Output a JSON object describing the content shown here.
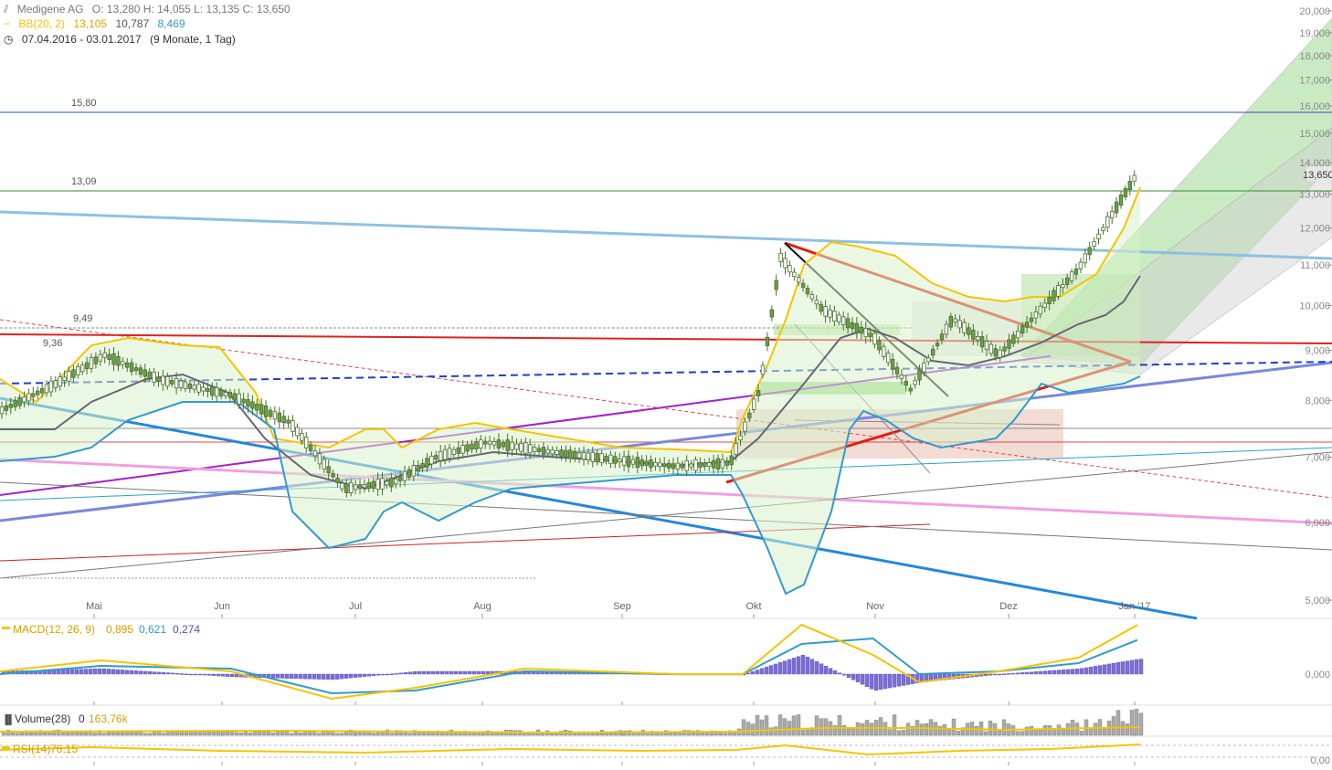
{
  "header": {
    "symbol": "Medigene AG",
    "ohlc": "O: 13,280  H: 14,055  L: 13,135  C: 13,650",
    "bb_label": "BB(20, 2)",
    "bb_upper": "13,105",
    "bb_mid": "10,787",
    "bb_lower": "8,469",
    "date_range": "07.04.2016 - 03.01.2017",
    "period": "(9 Monate, 1 Tag)"
  },
  "colors": {
    "candle_up": "#6b9e4a",
    "bb_upper": "#f5c400",
    "bb_mid": "#666677",
    "bb_lower": "#3399cc",
    "macd_line": "#f5c400",
    "signal_line": "#3399cc",
    "histogram": "#7a6fd6",
    "volume": "#aaaaaa",
    "volume_avg": "#f5c400",
    "rsi": "#f5c400"
  },
  "level_labels": {
    "l1580": "15,80",
    "l1309": "13,09",
    "l949": "9,49",
    "l936": "9,36"
  },
  "last_price_tag": "13,650",
  "macd": {
    "label": "MACD(12, 26, 9)",
    "v1": "0,895",
    "v2": "0,621",
    "v3": "0,274",
    "axis_zero": "0,000"
  },
  "volume": {
    "label": "Volume(28)",
    "v1": "0",
    "v2": "163,76k"
  },
  "rsi": {
    "label": "RSI(14)",
    "v1": "76,15",
    "axis_zero": "0,00"
  },
  "chart_data": {
    "type": "line",
    "title": "Medigene AG",
    "ylim": [
      5.0,
      20.0
    ],
    "y_ticks": [
      "5,000",
      "6,000",
      "7,000",
      "8,000",
      "9,000",
      "10,000",
      "11,000",
      "12,000",
      "13,000",
      "14,000",
      "15,000",
      "16,000",
      "17,000",
      "18,000",
      "19,000",
      "20,000"
    ],
    "x_ticks": [
      "Mai",
      "Jun",
      "Jul",
      "Aug",
      "Sep",
      "Okt",
      "Nov",
      "Dez",
      "Jan '17"
    ],
    "horizontal_levels": [
      15.8,
      13.09,
      9.49,
      9.36
    ],
    "price_series": {
      "name": "Close",
      "x": [
        "2016-04-07",
        "2016-04-20",
        "2016-05-02",
        "2016-05-15",
        "2016-06-01",
        "2016-06-15",
        "2016-06-28",
        "2016-07-10",
        "2016-07-20",
        "2016-08-01",
        "2016-08-15",
        "2016-09-01",
        "2016-09-15",
        "2016-09-28",
        "2016-10-05",
        "2016-10-10",
        "2016-10-20",
        "2016-11-01",
        "2016-11-10",
        "2016-11-20",
        "2016-12-01",
        "2016-12-10",
        "2016-12-20",
        "2017-01-03"
      ],
      "y": [
        7.8,
        8.3,
        8.9,
        8.4,
        8.1,
        7.6,
        6.5,
        6.6,
        7.0,
        7.25,
        7.1,
        6.95,
        6.85,
        6.9,
        8.2,
        11.2,
        9.9,
        9.3,
        8.2,
        9.7,
        8.9,
        9.8,
        10.9,
        13.65
      ]
    },
    "bollinger": {
      "label": "BB(20, 2)",
      "upper": [
        8.3,
        8.7,
        9.5,
        9.2,
        8.9,
        8.2,
        7.2,
        6.5,
        7.5,
        7.6,
        7.4,
        7.2,
        7.05,
        7.15,
        8.5,
        11.3,
        11.7,
        11.2,
        10.2,
        10.3,
        10.2,
        10.3,
        11.0,
        13.1
      ],
      "middle": [
        7.8,
        8.1,
        8.4,
        8.5,
        8.1,
        7.5,
        6.8,
        6.6,
        6.8,
        7.0,
        7.0,
        6.95,
        6.85,
        6.75,
        7.0,
        7.8,
        8.9,
        9.5,
        9.1,
        9.2,
        9.1,
        9.3,
        9.7,
        10.79
      ]
    },
    "macd_series": {
      "name": "MACD(12, 26, 9)",
      "x": [
        "2016-04-07",
        "2016-05-01",
        "2016-06-01",
        "2016-06-25",
        "2016-07-15",
        "2016-08-10",
        "2016-09-15",
        "2016-10-01",
        "2016-10-15",
        "2016-11-01",
        "2016-11-12",
        "2016-12-01",
        "2016-12-20",
        "2017-01-03"
      ],
      "macd": [
        0.05,
        0.25,
        0.05,
        -0.45,
        -0.25,
        0.1,
        0.0,
        0.0,
        0.9,
        0.35,
        -0.15,
        0.05,
        0.3,
        0.895
      ],
      "signal": [
        0.0,
        0.15,
        0.1,
        -0.35,
        -0.3,
        0.05,
        0.0,
        0.0,
        0.55,
        0.65,
        0.0,
        0.05,
        0.2,
        0.621
      ],
      "histogram": [
        0.05,
        0.1,
        -0.05,
        -0.1,
        0.05,
        0.05,
        0.0,
        0.0,
        0.35,
        -0.3,
        -0.15,
        0.0,
        0.1,
        0.274
      ]
    },
    "volume_series": {
      "name": "Volume(28)",
      "average": 163760
    },
    "rsi_series": {
      "name": "RSI(14)",
      "last": 76.15
    }
  }
}
